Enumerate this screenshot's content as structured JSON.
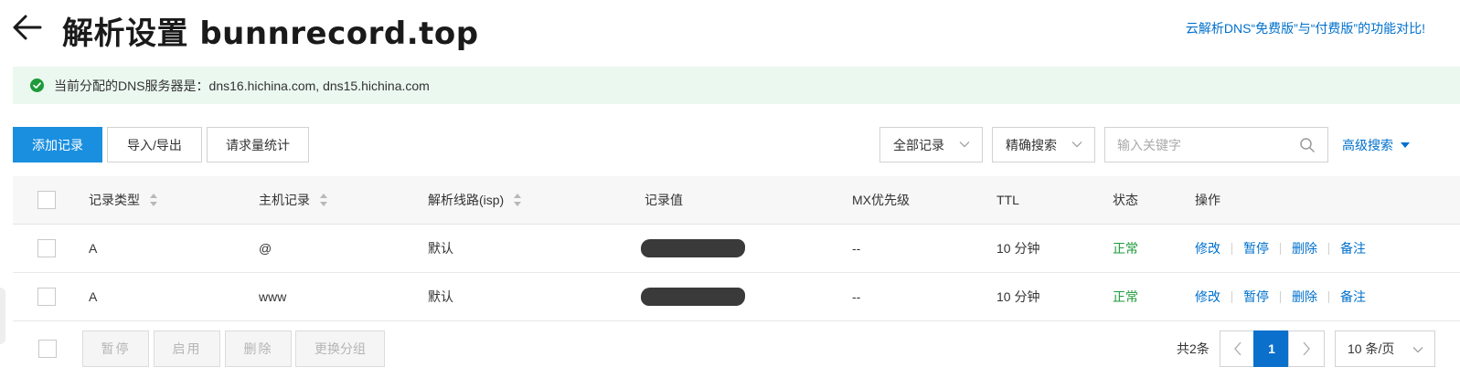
{
  "header": {
    "title": "解析设置 bunnrecord.top",
    "compare_link": "云解析DNS“免费版”与“付费版”的功能对比!"
  },
  "notice": {
    "text": "当前分配的DNS服务器是：dns16.hichina.com, dns15.hichina.com"
  },
  "toolbar": {
    "add_record": "添加记录",
    "import_export": "导入/导出",
    "request_stats": "请求量统计",
    "record_filter": "全部记录",
    "search_mode": "精确搜索",
    "search_placeholder": "输入关键字",
    "advanced_search": "高级搜索"
  },
  "table": {
    "columns": [
      "记录类型",
      "主机记录",
      "解析线路(isp)",
      "记录值",
      "MX优先级",
      "TTL",
      "状态",
      "操作"
    ],
    "rows": [
      {
        "type": "A",
        "host": "@",
        "line": "默认",
        "value_redacted": true,
        "mx": "--",
        "ttl": "10 分钟",
        "status": "正常",
        "ops": [
          "修改",
          "暂停",
          "删除",
          "备注"
        ]
      },
      {
        "type": "A",
        "host": "www",
        "line": "默认",
        "value_redacted": true,
        "mx": "--",
        "ttl": "10 分钟",
        "status": "正常",
        "ops": [
          "修改",
          "暂停",
          "删除",
          "备注"
        ]
      }
    ]
  },
  "footer": {
    "bulk_actions": [
      "暂停",
      "启用",
      "删除",
      "更换分组"
    ],
    "total": "共2条",
    "current_page": "1",
    "page_size": "10 条/页"
  },
  "colors": {
    "primary": "#1a8fe0",
    "link": "#0070cc",
    "status_ok": "#1e9a3a",
    "notice_bg": "#ebf8f0"
  }
}
